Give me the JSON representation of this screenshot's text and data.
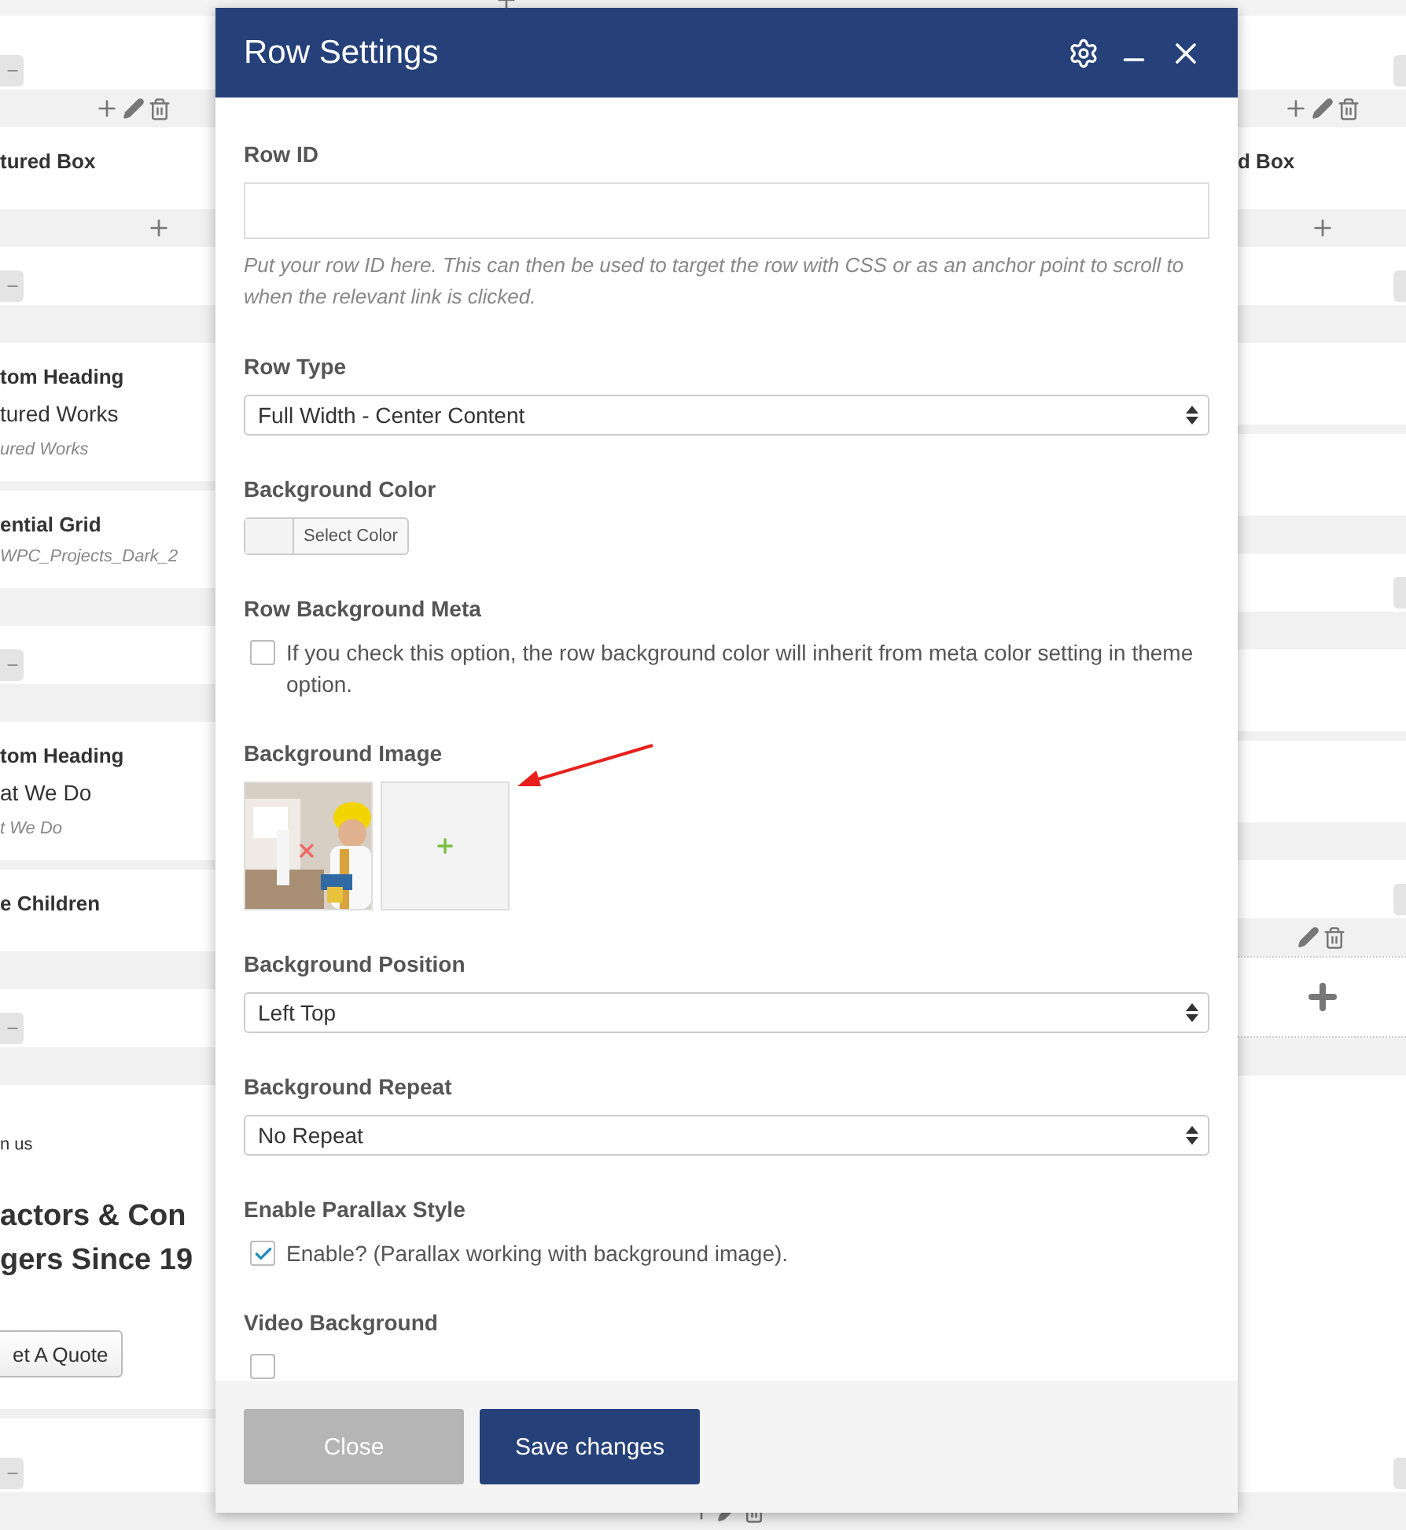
{
  "builder": {
    "left_column": [
      {
        "kind": "strip"
      },
      {
        "kind": "space"
      },
      {
        "kind": "handle"
      },
      {
        "kind": "bar",
        "tools": [
          {
            "kind": "add"
          },
          {
            "kind": "edit"
          },
          {
            "kind": "delete"
          }
        ]
      },
      {
        "kind": "content",
        "items": [
          {
            "kind": "heading",
            "text": "tured Box"
          }
        ]
      },
      {
        "kind": "bar",
        "tools": [
          {
            "kind": "add"
          }
        ]
      },
      {
        "kind": "space"
      },
      {
        "kind": "handle"
      },
      {
        "kind": "bar"
      },
      {
        "kind": "content",
        "items": [
          {
            "kind": "heading",
            "text": "tom Heading"
          },
          {
            "kind": "title",
            "text": "tured Works"
          },
          {
            "kind": "subtitle",
            "text": "ured Works"
          }
        ]
      },
      {
        "kind": "divider"
      },
      {
        "kind": "content",
        "items": [
          {
            "kind": "heading",
            "text": "ential Grid"
          },
          {
            "kind": "subtitle",
            "text": "WPC_Projects_Dark_2"
          }
        ]
      },
      {
        "kind": "bar"
      },
      {
        "kind": "space"
      },
      {
        "kind": "handle"
      },
      {
        "kind": "bar"
      },
      {
        "kind": "content",
        "items": [
          {
            "kind": "heading",
            "text": "tom Heading"
          },
          {
            "kind": "title",
            "text": "at We Do"
          },
          {
            "kind": "subtitle",
            "text": "t We Do"
          }
        ]
      },
      {
        "kind": "divider"
      },
      {
        "kind": "content",
        "items": [
          {
            "kind": "heading",
            "text": "e Children"
          }
        ]
      },
      {
        "kind": "bar"
      },
      {
        "kind": "space"
      },
      {
        "kind": "handle"
      },
      {
        "kind": "bar"
      },
      {
        "kind": "content",
        "items": [
          {
            "kind": "small",
            "text": "n us"
          },
          {
            "kind": "large",
            "text": "actors & Con"
          },
          {
            "kind": "large",
            "text": "gers Since 19"
          },
          {
            "kind": "button",
            "text": "et A Quote"
          }
        ]
      },
      {
        "kind": "divider"
      },
      {
        "kind": "fill"
      },
      {
        "kind": "handle"
      },
      {
        "kind": "bar"
      }
    ],
    "middle_column": [
      {
        "kind": "strip",
        "tools": [
          {
            "kind": "add"
          }
        ]
      },
      {
        "kind": "fill"
      },
      {
        "kind": "bar",
        "tools": [
          {
            "kind": "add"
          },
          {
            "kind": "edit"
          },
          {
            "kind": "delete"
          }
        ]
      }
    ],
    "right_column": [
      {
        "kind": "strip"
      },
      {
        "kind": "space"
      },
      {
        "kind": "handle"
      },
      {
        "kind": "bar",
        "tools": [
          {
            "kind": "add"
          },
          {
            "kind": "edit"
          },
          {
            "kind": "delete"
          }
        ]
      },
      {
        "kind": "content",
        "items": [
          {
            "kind": "heading",
            "text": "d Box"
          }
        ]
      },
      {
        "kind": "bar",
        "tools": [
          {
            "kind": "add"
          }
        ]
      },
      {
        "kind": "space"
      },
      {
        "kind": "handle"
      },
      {
        "kind": "bar"
      },
      {
        "kind": "content"
      },
      {
        "kind": "divider"
      },
      {
        "kind": "content"
      },
      {
        "kind": "bar"
      },
      {
        "kind": "space"
      },
      {
        "kind": "handle"
      },
      {
        "kind": "bar"
      },
      {
        "kind": "content"
      },
      {
        "kind": "divider"
      },
      {
        "kind": "content"
      },
      {
        "kind": "bar"
      },
      {
        "kind": "space"
      },
      {
        "kind": "handle"
      },
      {
        "kind": "bar",
        "tools": [
          {
            "kind": "edit"
          },
          {
            "kind": "delete"
          }
        ]
      },
      {
        "kind": "drop-zone"
      },
      {
        "kind": "bar"
      },
      {
        "kind": "fill"
      },
      {
        "kind": "handle"
      },
      {
        "kind": "bar"
      }
    ]
  },
  "dialog": {
    "title": "Row Settings",
    "fields": [
      {
        "kind": "text-input",
        "label": "Row ID",
        "help": "Put your row ID here. This can then be used to target the row with CSS or as an anchor point to scroll to when the relevant link is clicked."
      },
      {
        "kind": "select",
        "label": "Row Type",
        "value": "Full Width - Center Content"
      },
      {
        "kind": "color",
        "label": "Background Color",
        "button": "Select Color"
      },
      {
        "kind": "checkbox",
        "label": "Row Background Meta",
        "option": "If you check this option, the row background color will inherit from meta color setting in theme option.",
        "checked": false
      },
      {
        "kind": "images",
        "label": "Background Image",
        "annotation": {
          "kind": "arrow"
        }
      },
      {
        "kind": "select",
        "label": "Background Position",
        "value": "Left Top"
      },
      {
        "kind": "select",
        "label": "Background Repeat",
        "value": "No Repeat"
      },
      {
        "kind": "checkbox",
        "label": "Enable Parallax Style",
        "option": "Enable? (Parallax working with background image).",
        "checked": true
      },
      {
        "kind": "checkbox",
        "label": "Video Background",
        "checked": false
      }
    ],
    "buttons": [
      {
        "kind": "secondary",
        "label": "Close"
      },
      {
        "kind": "primary",
        "label": "Save changes"
      }
    ]
  }
}
